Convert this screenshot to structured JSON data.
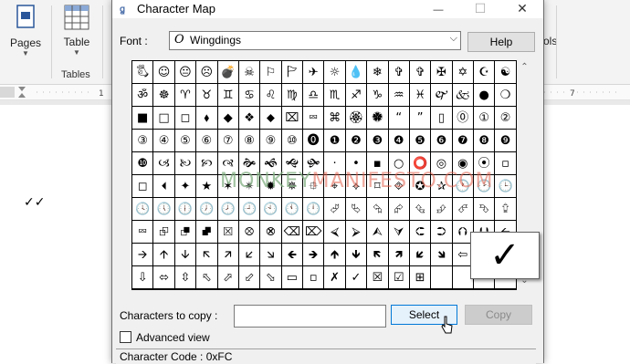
{
  "word": {
    "ribbon": {
      "pages_label": "Pages",
      "table_label": "Table",
      "tables_group": "Tables",
      "right_partial": "ols"
    },
    "doc_text": "✓✓"
  },
  "window": {
    "title": "Character Map",
    "minimize": "—",
    "maximize": "☐",
    "close": "✕"
  },
  "font": {
    "label": "Font :",
    "value": "Wingdings",
    "glyph": "O",
    "help_button": "Help"
  },
  "grid": {
    "rows": [
      [
        "🖏",
        "☺",
        "😐",
        "☹",
        "💣",
        "☠",
        "⚐",
        "🏱",
        "✈",
        "☼",
        "💧",
        "❄",
        "✞",
        "✞",
        "✠",
        "✡",
        "☪",
        "☯"
      ],
      [
        "ॐ",
        "☸",
        "♈",
        "♉",
        "♊",
        "♋",
        "♌",
        "♍",
        "♎",
        "♏",
        "♐",
        "♑",
        "♒",
        "♓",
        "🙰",
        "🙵",
        "●",
        "❍"
      ],
      [
        "■",
        "□",
        "◻",
        "⬧",
        "◆",
        "❖",
        "⬥",
        "⌧",
        "⮹",
        "⌘",
        "🏵",
        "🏶",
        "“",
        "”",
        "▯",
        "⓪",
        "①",
        "②"
      ],
      [
        "③",
        "④",
        "⑤",
        "⑥",
        "⑦",
        "⑧",
        "⑨",
        "⑩",
        "⓿",
        "❶",
        "❷",
        "❸",
        "❹",
        "❺",
        "❻",
        "❼",
        "❽",
        "❾"
      ],
      [
        "❿",
        "🙢",
        "🙠",
        "🙡",
        "🙣",
        "🙞",
        "🙜",
        "🙝",
        "🙟",
        "·",
        "•",
        "▪",
        "○",
        "⭕",
        "◎",
        "◉",
        "⦿",
        "▫"
      ],
      [
        "◻",
        "🞀",
        "✦",
        "★",
        "✶",
        "✴",
        "✹",
        "✵",
        "⯐",
        "⌖",
        "⟡",
        "⌑",
        "⯑",
        "✪",
        "✰",
        "🕐",
        "🕑",
        "🕒"
      ],
      [
        "🕓",
        "🕔",
        "🕕",
        "🕖",
        "🕗",
        "🕘",
        "🕙",
        "🕚",
        "🕛",
        "⮰",
        "⮱",
        "⮲",
        "⮳",
        "⮴",
        "⮵",
        "⮶",
        "⮷",
        "⮸"
      ],
      [
        "⮹",
        "⮺",
        "⮻",
        "⮼",
        "⮽",
        "⮾",
        "⮿",
        "⌫",
        "⌦",
        "⮘",
        "⮚",
        "⮙",
        "⮛",
        "⮈",
        "⮊",
        "⮉",
        "⮋",
        "🡨"
      ],
      [
        "🡪",
        "🡩",
        "🡫",
        "🡬",
        "🡭",
        "🡯",
        "🡮",
        "🡸",
        "🡺",
        "🡹",
        "🡻",
        "🡼",
        "🡽",
        "🡿",
        "🡾",
        "⇦",
        "⇨",
        "⇧"
      ],
      [
        "⇩",
        "⬄",
        "⇳",
        "⬁",
        "⬀",
        "⬃",
        "⬂",
        "▭",
        "▫",
        "✗",
        "✓",
        "☒",
        "☑",
        "⊞",
        "",
        "",
        "",
        ""
      ]
    ],
    "selected_glyph": "✓"
  },
  "watermark": {
    "part1": "MONKEY",
    "part2": "MANIFESTO.COM"
  },
  "copy": {
    "label": "Characters to copy :",
    "value": "",
    "select_button": "Select",
    "copy_button": "Copy"
  },
  "advanced_view": {
    "label": "Advanced view",
    "checked": false
  },
  "status": {
    "text": "Character Code : 0xFC"
  },
  "colors": {
    "select_button_border": "#0078d7",
    "select_button_bg": "#e5f1fb",
    "watermark": "#e15f4b"
  }
}
